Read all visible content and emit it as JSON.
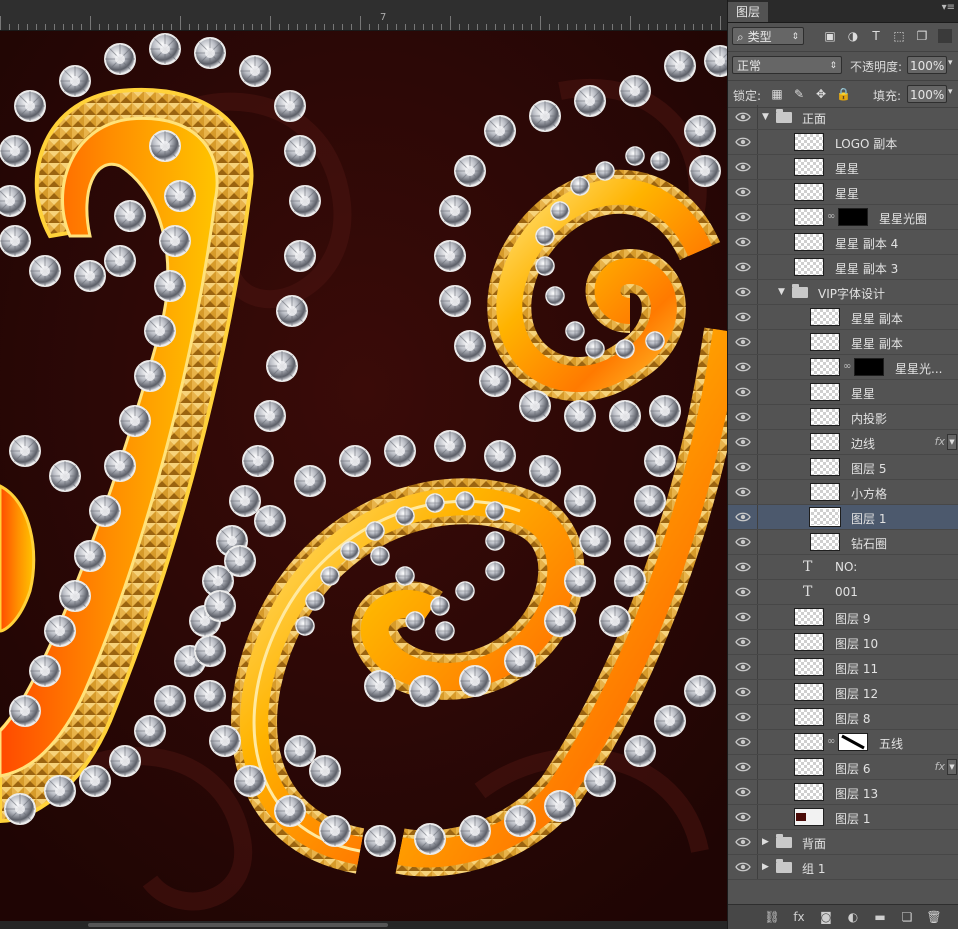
{
  "ruler": {
    "marker": "7"
  },
  "panel": {
    "tab_label": "图层",
    "menu_glyph": "▾≡",
    "filter": {
      "kind": "类型",
      "search_glyph": "⌕"
    },
    "blend_mode": "正常",
    "opacity_label": "不透明度:",
    "opacity_value": "100%",
    "lock_label": "锁定:",
    "fill_label": "填充:",
    "fill_value": "100%"
  },
  "layers": [
    {
      "kind": "group",
      "name": "正面",
      "indent": 0,
      "open": true
    },
    {
      "kind": "pixel",
      "name": "LOGO 副本",
      "indent": 1
    },
    {
      "kind": "pixel",
      "name": "星星",
      "indent": 1
    },
    {
      "kind": "pixel",
      "name": "星星",
      "indent": 1
    },
    {
      "kind": "masked",
      "name": "星星光圈",
      "indent": 1
    },
    {
      "kind": "pixel",
      "name": "星星 副本 4",
      "indent": 1
    },
    {
      "kind": "pixel",
      "name": "星星 副本 3",
      "indent": 1
    },
    {
      "kind": "group",
      "name": "VIP字体设计",
      "indent": 1,
      "open": true
    },
    {
      "kind": "pixel",
      "name": "星星 副本",
      "indent": 2
    },
    {
      "kind": "pixel",
      "name": "星星 副本",
      "indent": 2
    },
    {
      "kind": "masked",
      "name": "星星光...",
      "indent": 2
    },
    {
      "kind": "pixel",
      "name": "星星",
      "indent": 2
    },
    {
      "kind": "pixel",
      "name": "内投影",
      "indent": 2
    },
    {
      "kind": "pixel",
      "name": "边线",
      "indent": 2,
      "fx": true
    },
    {
      "kind": "pixel",
      "name": "图层 5",
      "indent": 2
    },
    {
      "kind": "pixel",
      "name": "小方格",
      "indent": 2
    },
    {
      "kind": "pixel",
      "name": "图层 1",
      "indent": 2,
      "selected": true
    },
    {
      "kind": "pixel",
      "name": "钻石圈",
      "indent": 2
    },
    {
      "kind": "text",
      "name": "NO:",
      "indent": 1
    },
    {
      "kind": "text",
      "name": "001",
      "indent": 1
    },
    {
      "kind": "pixel",
      "name": "图层 9",
      "indent": 1
    },
    {
      "kind": "pixel",
      "name": "图层 10",
      "indent": 1
    },
    {
      "kind": "pixel",
      "name": "图层 11",
      "indent": 1
    },
    {
      "kind": "pixel",
      "name": "图层 12",
      "indent": 1
    },
    {
      "kind": "pixel",
      "name": "图层 8",
      "indent": 1
    },
    {
      "kind": "masked-white",
      "name": "五线",
      "indent": 1
    },
    {
      "kind": "pixel",
      "name": "图层 6",
      "indent": 1,
      "fx": true
    },
    {
      "kind": "pixel",
      "name": "图层 13",
      "indent": 1
    },
    {
      "kind": "pixel-dark",
      "name": "图层 1",
      "indent": 1
    },
    {
      "kind": "group",
      "name": "背面",
      "indent": 0,
      "open": false
    },
    {
      "kind": "group",
      "name": "组 1",
      "indent": 0,
      "open": false
    }
  ],
  "fx_label": "fx",
  "text_icon_glyph": "T",
  "footer_icons": [
    {
      "name": "link-layers-icon",
      "glyph": "⛓"
    },
    {
      "name": "layer-style-icon",
      "glyph": "fx"
    },
    {
      "name": "add-mask-icon",
      "glyph": "◙"
    },
    {
      "name": "adjustment-layer-icon",
      "glyph": "◐"
    },
    {
      "name": "new-group-icon",
      "glyph": "▬"
    },
    {
      "name": "new-layer-icon",
      "glyph": "❏"
    },
    {
      "name": "delete-layer-icon",
      "glyph": "🗑"
    }
  ],
  "colors": {
    "canvas_bg": "#2a0706",
    "gold_light": "#ffd23a",
    "gold_dark": "#c77a00",
    "orange": "#ff6a00",
    "selected_row": "#4c596d",
    "panel_bg": "#535353"
  }
}
